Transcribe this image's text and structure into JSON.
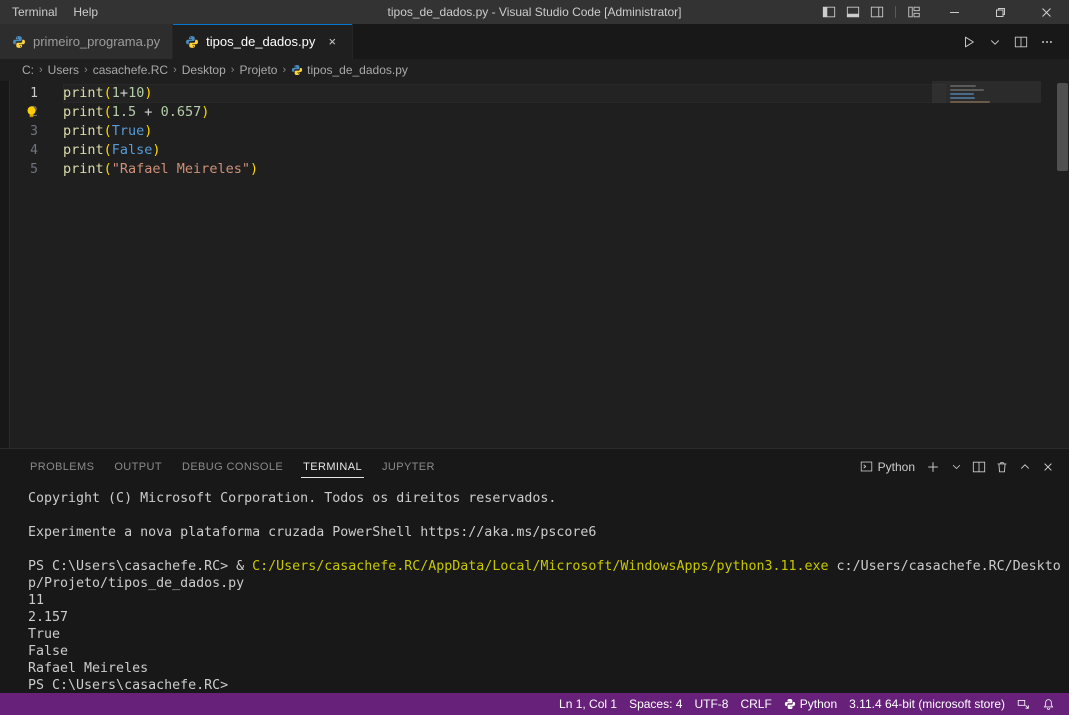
{
  "window": {
    "title": "tipos_de_dados.py - Visual Studio Code [Administrator]",
    "menu": [
      {
        "label": "Terminal",
        "name": "menu-terminal"
      },
      {
        "label": "Help",
        "name": "menu-help"
      }
    ],
    "layout_icons": [
      {
        "name": "toggle-primary-sidebar-icon"
      },
      {
        "name": "toggle-panel-icon"
      },
      {
        "name": "toggle-secondary-sidebar-icon"
      },
      {
        "name": "customize-layout-icon"
      }
    ],
    "controls": {
      "minimize": "minimize-icon",
      "restore": "restore-icon",
      "close": "close-icon"
    }
  },
  "tabs": [
    {
      "label": "primeiro_programa.py",
      "active": false,
      "icon": "python-file-icon"
    },
    {
      "label": "tipos_de_dados.py",
      "active": true,
      "icon": "python-file-icon",
      "close": "×"
    }
  ],
  "editor_actions": [
    {
      "name": "run-python-file-button",
      "icon": "play-icon"
    },
    {
      "name": "run-options-dropdown",
      "icon": "chevron-down-icon"
    },
    {
      "name": "split-editor-right-button",
      "icon": "split-editor-icon"
    },
    {
      "name": "more-actions-button",
      "icon": "ellipsis-icon"
    }
  ],
  "breadcrumb": {
    "items": [
      "C:",
      "Users",
      "casachefe.RC",
      "Desktop",
      "Projeto",
      "tipos_de_dados.py"
    ],
    "separator": "›",
    "file_icon": "python-file-icon"
  },
  "code": {
    "lines": [
      {
        "number": "1",
        "current": true,
        "has_bulb": false,
        "tokens": [
          {
            "t": "print",
            "c": "t-fn"
          },
          {
            "t": "(",
            "c": "t-punct"
          },
          {
            "t": "1",
            "c": "t-num"
          },
          {
            "t": "+",
            "c": "t-op"
          },
          {
            "t": "10",
            "c": "t-num"
          },
          {
            "t": ")",
            "c": "t-punct"
          }
        ]
      },
      {
        "number": "2",
        "current": false,
        "has_bulb": true,
        "tokens": [
          {
            "t": "print",
            "c": "t-fn"
          },
          {
            "t": "(",
            "c": "t-punct"
          },
          {
            "t": "1.5",
            "c": "t-num"
          },
          {
            "t": " + ",
            "c": "t-op"
          },
          {
            "t": "0.657",
            "c": "t-num"
          },
          {
            "t": ")",
            "c": "t-punct"
          }
        ]
      },
      {
        "number": "3",
        "current": false,
        "has_bulb": false,
        "tokens": [
          {
            "t": "print",
            "c": "t-fn"
          },
          {
            "t": "(",
            "c": "t-punct"
          },
          {
            "t": "True",
            "c": "t-kw"
          },
          {
            "t": ")",
            "c": "t-punct"
          }
        ]
      },
      {
        "number": "4",
        "current": false,
        "has_bulb": false,
        "tokens": [
          {
            "t": "print",
            "c": "t-fn"
          },
          {
            "t": "(",
            "c": "t-punct"
          },
          {
            "t": "False",
            "c": "t-kw"
          },
          {
            "t": ")",
            "c": "t-punct"
          }
        ]
      },
      {
        "number": "5",
        "current": false,
        "has_bulb": false,
        "tokens": [
          {
            "t": "print",
            "c": "t-fn"
          },
          {
            "t": "(",
            "c": "t-punct"
          },
          {
            "t": "\"Rafael Meireles\"",
            "c": "t-str"
          },
          {
            "t": ")",
            "c": "t-punct"
          }
        ]
      }
    ],
    "quick_fix_icon": "lightbulb-icon"
  },
  "panel": {
    "tabs": [
      {
        "label": "PROBLEMS",
        "active": false
      },
      {
        "label": "OUTPUT",
        "active": false
      },
      {
        "label": "DEBUG CONSOLE",
        "active": false
      },
      {
        "label": "TERMINAL",
        "active": true
      },
      {
        "label": "JUPYTER",
        "active": false
      }
    ],
    "terminal_kind": "Python",
    "actions": [
      {
        "name": "terminal-type-icon",
        "icon": "terminal-chevron-icon"
      },
      {
        "name": "new-terminal-button",
        "icon": "plus-icon"
      },
      {
        "name": "terminal-profile-dropdown",
        "icon": "chevron-down-icon"
      },
      {
        "name": "split-terminal-button",
        "icon": "split-icon"
      },
      {
        "name": "kill-terminal-button",
        "icon": "trash-icon"
      },
      {
        "name": "hide-panel-button",
        "icon": "chevron-up-icon"
      },
      {
        "name": "close-panel-button",
        "icon": "close-icon"
      }
    ],
    "terminal_lines": [
      {
        "segments": [
          {
            "text": "Copyright (C) Microsoft Corporation. Todos os direitos reservados.",
            "c": "c-white"
          }
        ]
      },
      {
        "segments": [
          {
            "text": "",
            "c": "c-white"
          }
        ]
      },
      {
        "segments": [
          {
            "text": "Experimente a nova plataforma cruzada PowerShell https://aka.ms/pscore6",
            "c": "c-white"
          }
        ]
      },
      {
        "segments": [
          {
            "text": "",
            "c": "c-white"
          }
        ]
      },
      {
        "segments": [
          {
            "text": "PS C:\\Users\\casachefe.RC> & ",
            "c": "c-white"
          },
          {
            "text": "C:/Users/casachefe.RC/AppData/Local/Microsoft/WindowsApps/python3.11.exe",
            "c": "c-yellow"
          },
          {
            "text": " c:/Users/casachefe.RC/Desktop/Projeto/tipos_de_dados.py",
            "c": "c-white"
          }
        ]
      },
      {
        "segments": [
          {
            "text": "11",
            "c": "c-white"
          }
        ]
      },
      {
        "segments": [
          {
            "text": "2.157",
            "c": "c-white"
          }
        ]
      },
      {
        "segments": [
          {
            "text": "True",
            "c": "c-white"
          }
        ]
      },
      {
        "segments": [
          {
            "text": "False",
            "c": "c-white"
          }
        ]
      },
      {
        "segments": [
          {
            "text": "Rafael Meireles",
            "c": "c-white"
          }
        ]
      },
      {
        "segments": [
          {
            "text": "PS C:\\Users\\casachefe.RC>",
            "c": "c-white"
          }
        ]
      }
    ]
  },
  "statusbar": {
    "items": [
      {
        "label": "Ln 1, Col 1",
        "name": "status-cursor-position",
        "icon": null
      },
      {
        "label": "Spaces: 4",
        "name": "status-indentation",
        "icon": null
      },
      {
        "label": "UTF-8",
        "name": "status-encoding",
        "icon": null
      },
      {
        "label": "CRLF",
        "name": "status-eol",
        "icon": null
      },
      {
        "label": "Python",
        "name": "status-language-mode",
        "icon": "python-icon"
      },
      {
        "label": "3.11.4 64-bit (microsoft store)",
        "name": "status-python-interpreter",
        "icon": null
      }
    ],
    "right_icons": [
      {
        "name": "remote-window-icon"
      },
      {
        "name": "notifications-bell-icon"
      }
    ],
    "background": "#68217a"
  },
  "colors": {
    "titlebar_bg": "#333333",
    "tabbar_bg": "#181818",
    "editor_bg": "#1f1f1f",
    "panel_bg": "#181818",
    "accent": "#0078d4",
    "statusbar": "#68217a",
    "python_blue": "#3fa7d6",
    "function_yellow": "#dcdcaa",
    "number_green": "#b5cea8",
    "keyword_blue": "#569cd6",
    "string_orange": "#ce9178",
    "terminal_yellow": "#c8c800"
  }
}
